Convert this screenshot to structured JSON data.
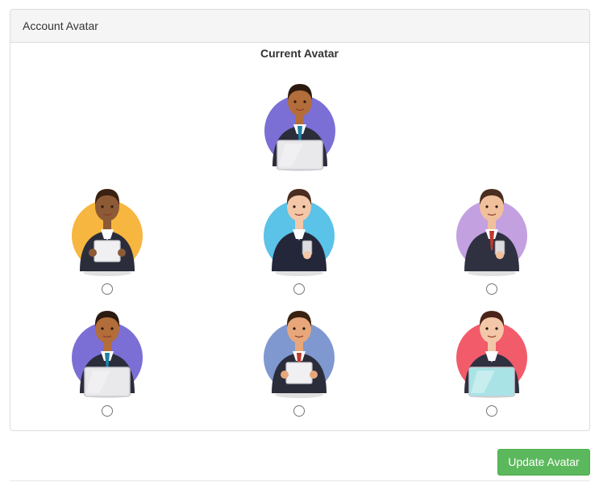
{
  "panel": {
    "title": "Account Avatar"
  },
  "current": {
    "title": "Current Avatar",
    "avatar": {
      "name": "man-laptop-blue-tie",
      "bg": "#7b6fd6",
      "skin": "#b36d3a",
      "hair": "#2b1a10",
      "suit": "#2b2d3b",
      "tie": "#1f7fa3",
      "prop": "laptop"
    }
  },
  "options": [
    {
      "name": "woman-tablet-curly",
      "bg": "#f7b63f",
      "skin": "#8d5a36",
      "hair": "#3a2212",
      "suit": "#2b2d3b",
      "tie": "none",
      "prop": "tablet",
      "selected": false
    },
    {
      "name": "woman-phone-long-hair",
      "bg": "#5bc2e8",
      "skin": "#f3c7a8",
      "hair": "#4a2e20",
      "suit": "#24263a",
      "tie": "none",
      "prop": "phone",
      "selected": false
    },
    {
      "name": "man-glasses-phone",
      "bg": "#c3a0e0",
      "skin": "#f0c09c",
      "hair": "#4a2e20",
      "suit": "#2f3140",
      "tie": "#c0392b",
      "prop": "phone",
      "selected": false
    },
    {
      "name": "man-laptop-blue-tie",
      "bg": "#7b6fd6",
      "skin": "#b36d3a",
      "hair": "#2b1a10",
      "suit": "#2b2d3b",
      "tie": "#1f7fa3",
      "prop": "laptop",
      "selected": false
    },
    {
      "name": "man-beard-tablet",
      "bg": "#7f98cf",
      "skin": "#e8a77a",
      "hair": "#3a2212",
      "suit": "#2b2d3b",
      "tie": "#c0392b",
      "prop": "tablet",
      "selected": false
    },
    {
      "name": "woman-glasses-laptop",
      "bg": "#f25b6a",
      "skin": "#f3c7a8",
      "hair": "#4a2418",
      "suit": "#2f3140",
      "tie": "none",
      "prop": "laptop-teal",
      "selected": false
    }
  ],
  "actions": {
    "update_label": "Update Avatar"
  }
}
